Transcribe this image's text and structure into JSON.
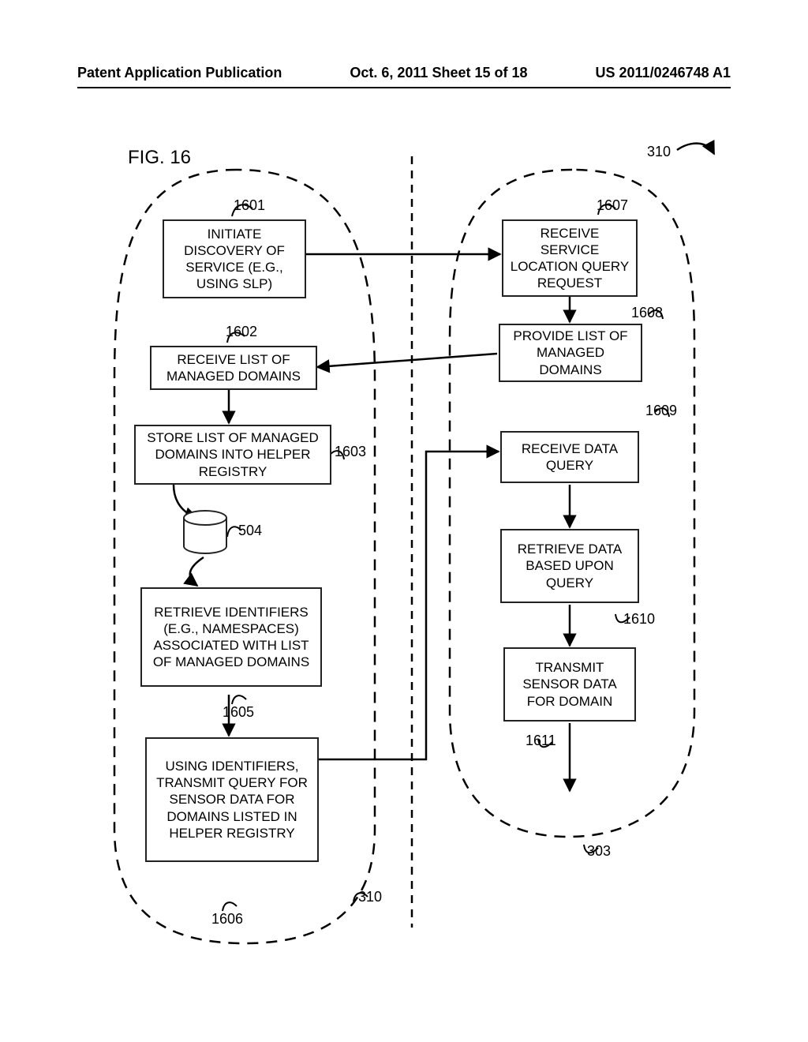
{
  "header": {
    "left": "Patent Application Publication",
    "center": "Oct. 6, 2011   Sheet 15 of 18",
    "right": "US 2011/0246748 A1"
  },
  "fig_label": "FIG. 16",
  "refs": {
    "r310a": "310",
    "r310b": "310",
    "r303": "303",
    "r504": "504",
    "r1601": "1601",
    "r1602": "1602",
    "r1603": "1603",
    "r1605": "1605",
    "r1606": "1606",
    "r1607": "1607",
    "r1608": "1608",
    "r1609": "1609",
    "r1610": "1610",
    "r1611": "1611"
  },
  "boxes": {
    "b1601": "INITIATE DISCOVERY OF SERVICE (E.G., USING SLP)",
    "b1602": "RECEIVE LIST OF MANAGED DOMAINS",
    "b1603": "STORE LIST OF MANAGED DOMAINS INTO HELPER REGISTRY",
    "b1605": "RETRIEVE IDENTIFIERS (E.G., NAMESPACES) ASSOCIATED WITH LIST OF MANAGED DOMAINS",
    "b1606": "USING IDENTIFIERS, TRANSMIT QUERY FOR SENSOR DATA FOR DOMAINS LISTED IN HELPER REGISTRY",
    "b1607": "RECEIVE SERVICE LOCATION QUERY REQUEST",
    "b1608": "PROVIDE LIST OF MANAGED DOMAINS",
    "b1609": "RECEIVE DATA QUERY",
    "b1610": "RETRIEVE DATA BASED UPON QUERY",
    "b1611": "TRANSMIT SENSOR DATA FOR DOMAIN"
  }
}
